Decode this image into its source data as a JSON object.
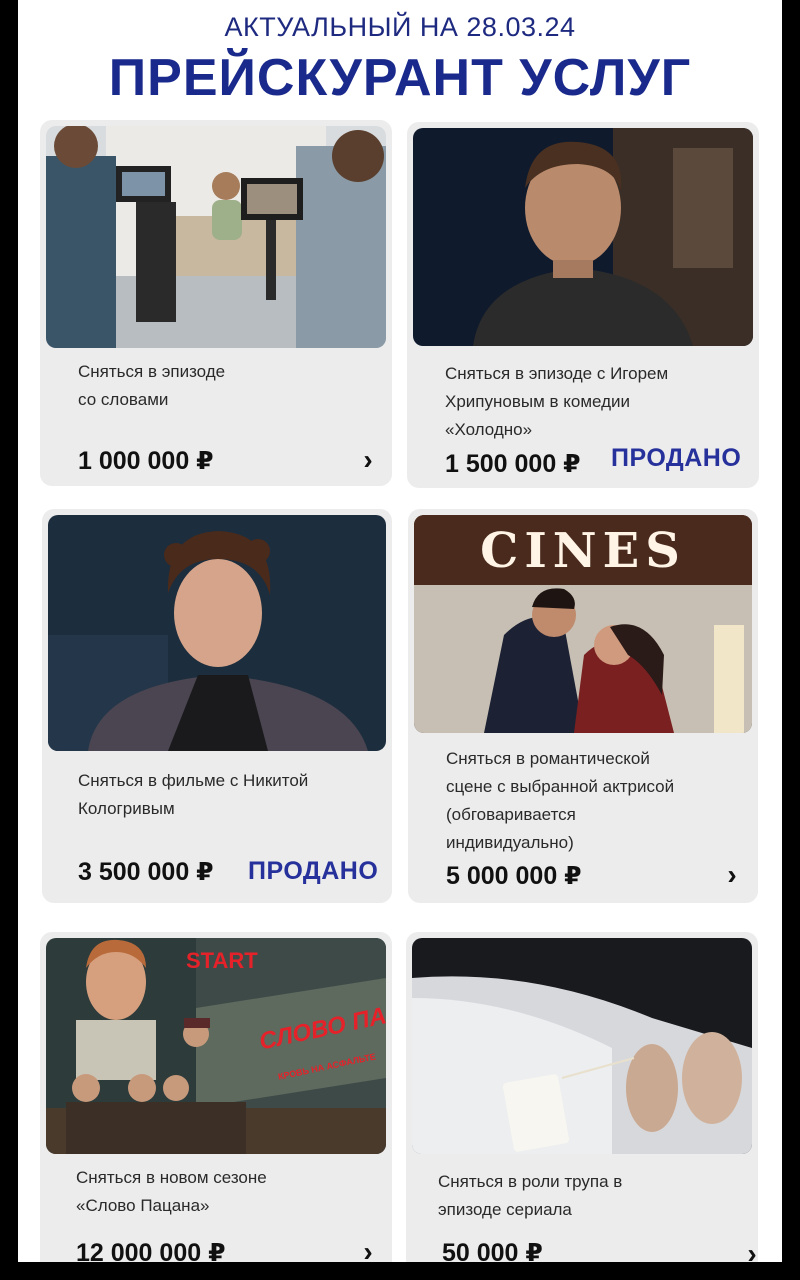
{
  "header": {
    "subtitle": "АКТУАЛЬНЫЙ НА 28.03.24",
    "title": "ПРЕЙСКУРАНТ УСЛУГ"
  },
  "cards": [
    {
      "photo": "film-crew-on-set-photo",
      "desc_lines": [
        "Сняться в эпизоде",
        "со словами"
      ],
      "price": "1 000 000 ₽",
      "status": "",
      "action_icon": "chevron-right-icon"
    },
    {
      "photo": "actor-portrait-photo",
      "desc_lines": [
        "Сняться в эпизоде с Игорем",
        "Хрипуновым в комедии",
        "«Холодно»"
      ],
      "price": "1 500 000 ₽",
      "status": "ПРОДАНО",
      "action_icon": ""
    },
    {
      "photo": "actor-on-stage-photo",
      "desc_lines": [
        "Сняться в фильме с Никитой",
        "Кологривым"
      ],
      "price": "3 500 000 ₽",
      "status": "ПРОДАНО",
      "action_icon": ""
    },
    {
      "photo": "romantic-scene-photo",
      "sign_text": "CINES",
      "desc_lines": [
        "Сняться в романтической",
        "сцене с выбранной актрисой",
        "(обговаривается",
        "индивидуально)"
      ],
      "price": "5 000 000 ₽",
      "status": "",
      "action_icon": "chevron-right-icon"
    },
    {
      "photo": "series-poster-photo",
      "poster_start": "START",
      "poster_title": "СЛОВО ПАЦАНА",
      "poster_subtitle": "КРОВЬ НА АСФАЛЬТЕ",
      "desc_lines": [
        "Сняться в новом сезоне",
        "«Слово Пацана»"
      ],
      "price": "12 000 000 ₽",
      "status": "",
      "action_icon": "chevron-right-icon"
    },
    {
      "photo": "corpse-with-toe-tag-photo",
      "desc_lines": [
        "Сняться в роли трупа в",
        "эпизоде сериала"
      ],
      "price": "50 000 ₽",
      "status": "",
      "action_icon": "chevron-right-icon"
    }
  ],
  "chevron_glyph": "›",
  "colors": {
    "accent": "#1a2a8c",
    "sold": "#26319b",
    "card_bg": "#ececec"
  }
}
